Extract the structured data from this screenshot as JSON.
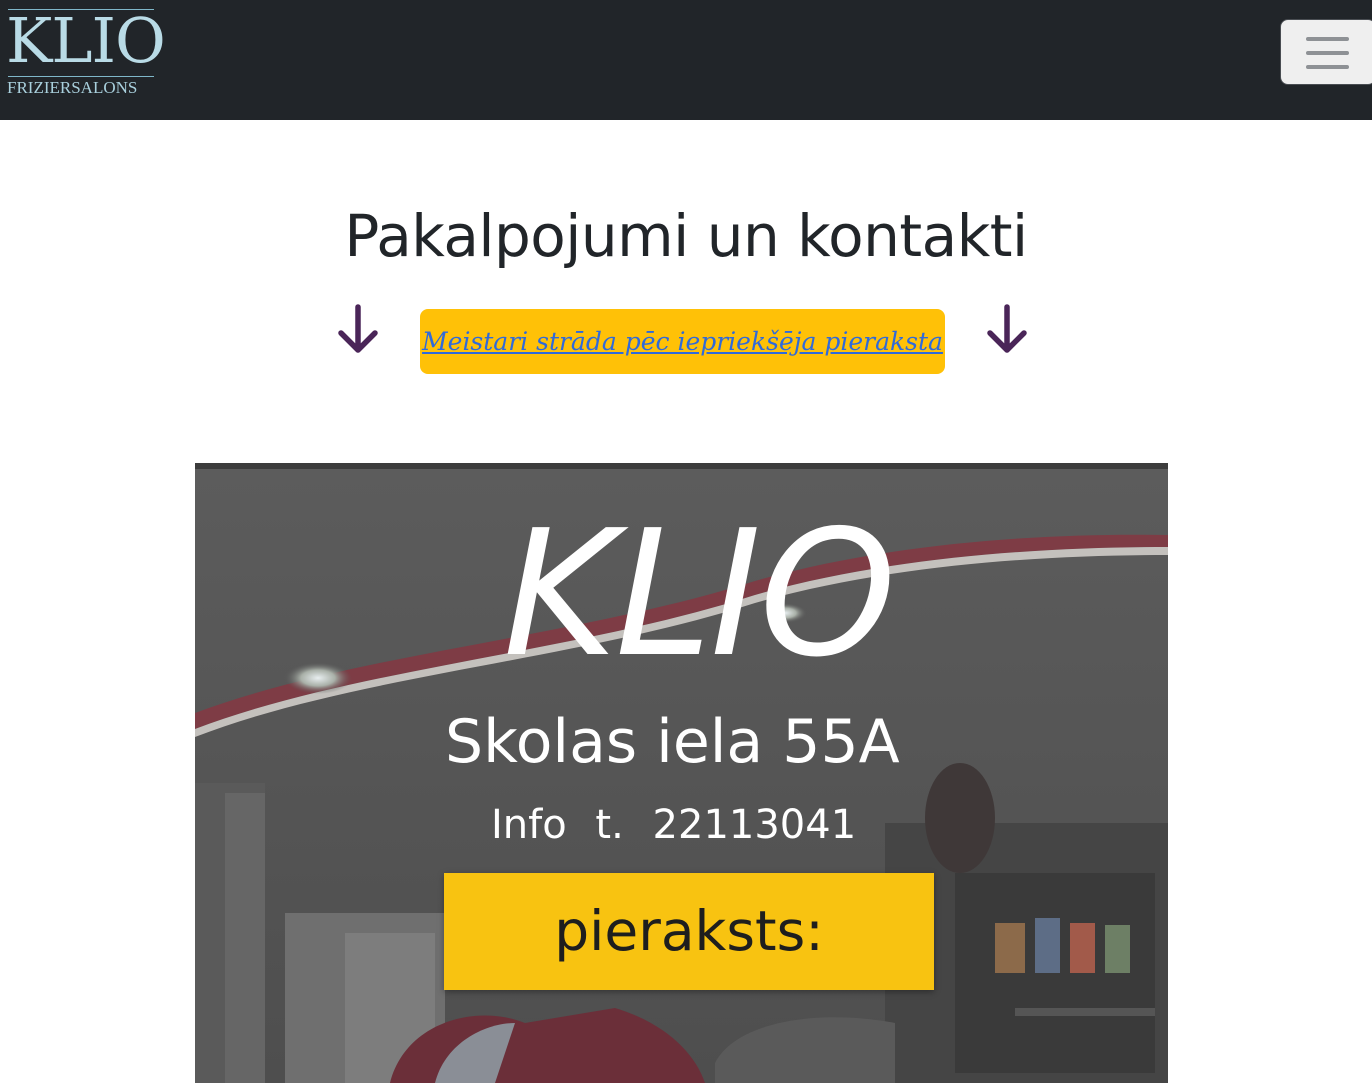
{
  "brand": {
    "title": "KLIO",
    "subtitle": "FRIZIERSALONS"
  },
  "navbar": {
    "toggle_icon": "hamburger-menu-icon"
  },
  "page": {
    "heading": "Pakalpojumi un kontakti",
    "notice_link": "Meistari strāda pēc iepriekšēja pieraksta",
    "arrow_icon": "arrow-down-icon",
    "colors": {
      "navbar": "#212529",
      "notice": "#ffc107",
      "link": "#2f6adb",
      "arrow": "#4a2558"
    }
  },
  "poster": {
    "name": "KLIO",
    "address": "Skolas iela 55A",
    "phone_label": "Info t.",
    "phone": "22113041",
    "booking_label": "pieraksts:"
  }
}
